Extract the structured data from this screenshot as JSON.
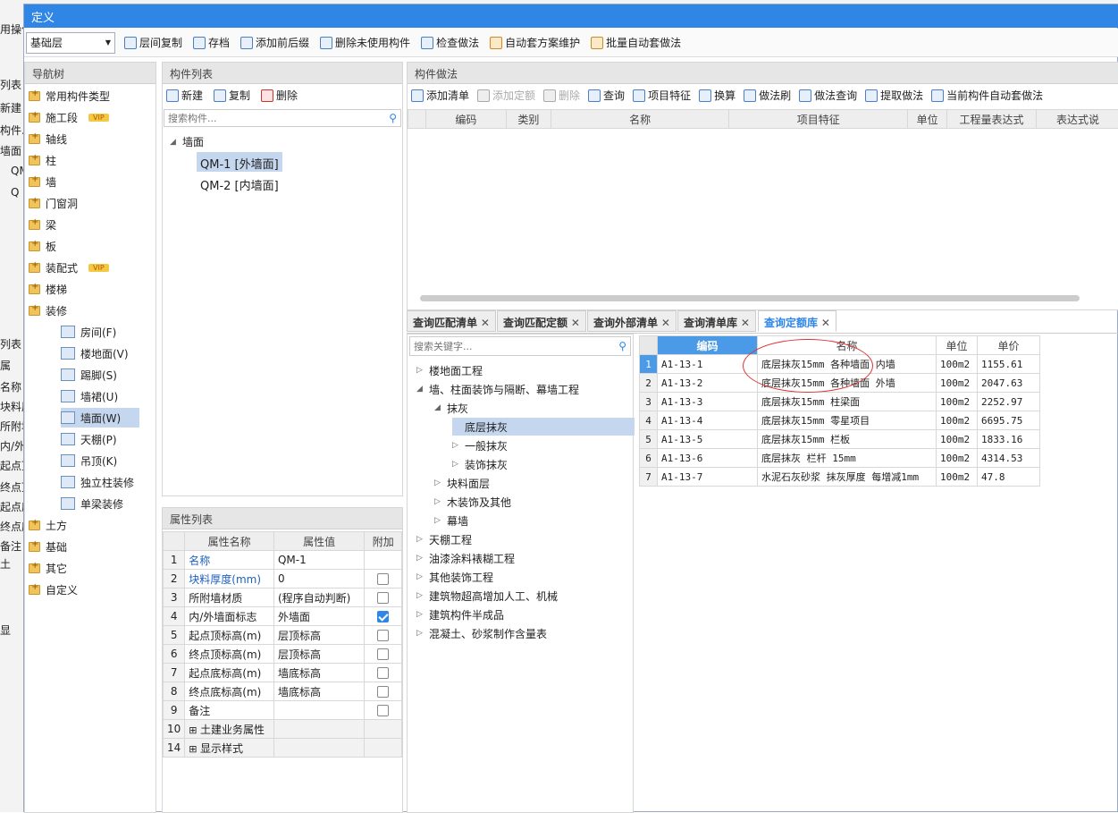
{
  "background_app": {
    "lines": [
      "用操作",
      "列表",
      "新建",
      "构件...",
      "墙面",
      "QM",
      "Q",
      "列表",
      "属",
      "名称",
      "块料厚",
      "所附墙",
      "内/外",
      "起点顶",
      "终点顶",
      "起点底",
      "终点底",
      "备注",
      "土",
      "显"
    ]
  },
  "title": "定义",
  "toolbar": {
    "layer_select": "基础层",
    "buttons": [
      "层间复制",
      "存档",
      "添加前后缀",
      "删除未使用构件",
      "检查做法",
      "自动套方案维护",
      "批量自动套做法"
    ]
  },
  "nav": {
    "title": "导航树",
    "items": [
      {
        "label": "常用构件类型",
        "vip": ""
      },
      {
        "label": "施工段",
        "vip": "VIP"
      },
      {
        "label": "轴线",
        "vip": ""
      },
      {
        "label": "柱",
        "vip": ""
      },
      {
        "label": "墙",
        "vip": ""
      },
      {
        "label": "门窗洞",
        "vip": ""
      },
      {
        "label": "梁",
        "vip": ""
      },
      {
        "label": "板",
        "vip": ""
      },
      {
        "label": "装配式",
        "vip": "VIP"
      },
      {
        "label": "楼梯",
        "vip": ""
      },
      {
        "label": "装修",
        "vip": ""
      }
    ],
    "sub_items": [
      "房间(F)",
      "楼地面(V)",
      "踢脚(S)",
      "墙裙(U)",
      "墙面(W)",
      "天棚(P)",
      "吊顶(K)",
      "独立柱装修",
      "单梁装修"
    ],
    "bottom_items": [
      "土方",
      "基础",
      "其它",
      "自定义"
    ]
  },
  "components": {
    "title": "构件列表",
    "buttons": [
      "新建",
      "复制",
      "删除"
    ],
    "search_placeholder": "搜索构件...",
    "group": "墙面",
    "items": [
      "QM-1 [外墙面]",
      "QM-2 [内墙面]"
    ]
  },
  "properties": {
    "title": "属性列表",
    "headers": [
      "属性名称",
      "属性值",
      "附加"
    ],
    "rows": [
      {
        "no": "1",
        "name": "名称",
        "value": "QM-1",
        "check": "none",
        "blue": true
      },
      {
        "no": "2",
        "name": "块料厚度(mm)",
        "value": "0",
        "check": "off",
        "blue": true
      },
      {
        "no": "3",
        "name": "所附墙材质",
        "value": "(程序自动判断)",
        "check": "off",
        "blue": false
      },
      {
        "no": "4",
        "name": "内/外墙面标志",
        "value": "外墙面",
        "check": "on",
        "blue": false
      },
      {
        "no": "5",
        "name": "起点顶标高(m)",
        "value": "层顶标高",
        "check": "off",
        "blue": false
      },
      {
        "no": "6",
        "name": "终点顶标高(m)",
        "value": "层顶标高",
        "check": "off",
        "blue": false
      },
      {
        "no": "7",
        "name": "起点底标高(m)",
        "value": "墙底标高",
        "check": "off",
        "blue": false
      },
      {
        "no": "8",
        "name": "终点底标高(m)",
        "value": "墙底标高",
        "check": "off",
        "blue": false
      },
      {
        "no": "9",
        "name": "备注",
        "value": "",
        "check": "off",
        "blue": false
      },
      {
        "no": "10",
        "name": "土建业务属性",
        "value": "",
        "check": "none",
        "blue": false
      },
      {
        "no": "14",
        "name": "显示样式",
        "value": "",
        "check": "none",
        "blue": false
      }
    ]
  },
  "method": {
    "title": "构件做法",
    "buttons": [
      "添加清单",
      "添加定额",
      "删除",
      "查询",
      "项目特征",
      "换算",
      "做法刷",
      "做法查询",
      "提取做法",
      "当前构件自动套做法"
    ],
    "headers": [
      "编码",
      "类别",
      "名称",
      "项目特征",
      "单位",
      "工程量表达式",
      "表达式说"
    ]
  },
  "tabs": [
    "查询匹配清单",
    "查询匹配定额",
    "查询外部清单",
    "查询清单库",
    "查询定额库"
  ],
  "tree": {
    "search_placeholder": "搜索关键字...",
    "nodes": [
      {
        "label": "楼地面工程",
        "level": 0,
        "arrow": "▷",
        "sel": false
      },
      {
        "label": "墙、柱面装饰与隔断、幕墙工程",
        "level": 0,
        "arrow": "◢",
        "sel": false
      },
      {
        "label": "抹灰",
        "level": 1,
        "arrow": "◢",
        "sel": false
      },
      {
        "label": "底层抹灰",
        "level": 2,
        "arrow": "",
        "sel": true
      },
      {
        "label": "一般抹灰",
        "level": 2,
        "arrow": "▷",
        "sel": false
      },
      {
        "label": "装饰抹灰",
        "level": 2,
        "arrow": "▷",
        "sel": false
      },
      {
        "label": "块料面层",
        "level": 1,
        "arrow": "▷",
        "sel": false
      },
      {
        "label": "木装饰及其他",
        "level": 1,
        "arrow": "▷",
        "sel": false
      },
      {
        "label": "幕墙",
        "level": 1,
        "arrow": "▷",
        "sel": false
      },
      {
        "label": "天棚工程",
        "level": 0,
        "arrow": "▷",
        "sel": false
      },
      {
        "label": "油漆涂料裱糊工程",
        "level": 0,
        "arrow": "▷",
        "sel": false
      },
      {
        "label": "其他装饰工程",
        "level": 0,
        "arrow": "▷",
        "sel": false
      },
      {
        "label": "建筑物超高增加人工、机械",
        "level": 0,
        "arrow": "▷",
        "sel": false
      },
      {
        "label": "建筑构件半成品",
        "level": 0,
        "arrow": "▷",
        "sel": false
      },
      {
        "label": "混凝土、砂浆制作含量表",
        "level": 0,
        "arrow": "▷",
        "sel": false
      }
    ]
  },
  "quota": {
    "headers": [
      "编码",
      "名称",
      "单位",
      "单价"
    ],
    "rows": [
      {
        "no": "1",
        "code": "A1-13-1",
        "name": "底层抹灰15mm 各种墙面 内墙",
        "unit": "100m2",
        "price": "1155.61"
      },
      {
        "no": "2",
        "code": "A1-13-2",
        "name": "底层抹灰15mm 各种墙面 外墙",
        "unit": "100m2",
        "price": "2047.63"
      },
      {
        "no": "3",
        "code": "A1-13-3",
        "name": "底层抹灰15mm 柱梁面",
        "unit": "100m2",
        "price": "2252.97"
      },
      {
        "no": "4",
        "code": "A1-13-4",
        "name": "底层抹灰15mm 零星项目",
        "unit": "100m2",
        "price": "6695.75"
      },
      {
        "no": "5",
        "code": "A1-13-5",
        "name": "底层抹灰15mm 栏板",
        "unit": "100m2",
        "price": "1833.16"
      },
      {
        "no": "6",
        "code": "A1-13-6",
        "name": "底层抹灰 栏杆 15mm",
        "unit": "100m2",
        "price": "4314.53"
      },
      {
        "no": "7",
        "code": "A1-13-7",
        "name": "水泥石灰砂浆 抹灰厚度 每增减1mm",
        "unit": "100m2",
        "price": "47.8"
      }
    ]
  }
}
